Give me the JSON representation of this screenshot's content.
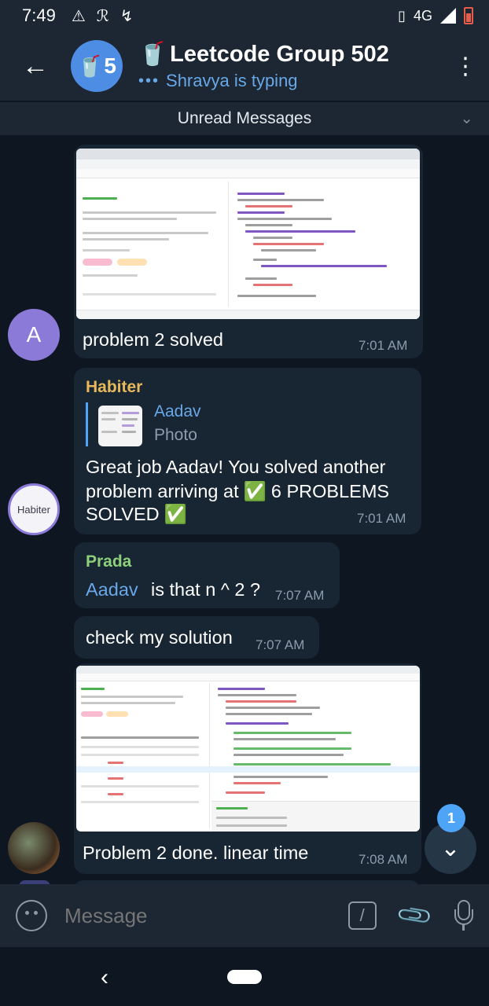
{
  "status_bar": {
    "time": "7:49",
    "network": "4G"
  },
  "header": {
    "avatar_count": "5",
    "title": "Leetcode Group 502",
    "typing": "Shravya is typing"
  },
  "unread_label": "Unread Messages",
  "messages": [
    {
      "sender_initial": "A",
      "text": "problem 2 solved",
      "time": "7:01 AM"
    },
    {
      "sender": "Habiter",
      "sender_avatar": "Habiter",
      "reply_name": "Aadav",
      "reply_type": "Photo",
      "text_line1": "Great job Aadav! You solved another",
      "text_line2": "problem arriving at",
      "text_line2b": "6 PROBLEMS",
      "text_line3": "SOLVED",
      "time": "7:01 AM"
    },
    {
      "sender": "Prada",
      "mention": "Aadav",
      "text": "is that n ^ 2 ?",
      "time": "7:07 AM"
    },
    {
      "text": "check my solution",
      "time": "7:07 AM"
    },
    {
      "text": "Problem 2 done. linear time",
      "time": "7:08 AM"
    }
  ],
  "input": {
    "placeholder": "Message"
  },
  "fab": {
    "badge": "1"
  },
  "colors": {
    "background": "#0e1621",
    "bubble": "#182533",
    "header": "#1c2733",
    "accent": "#4ea4f6",
    "habiter_name": "#e8b95a",
    "prada_name": "#8ed07a",
    "avatar_a": "#8c7ad8"
  }
}
